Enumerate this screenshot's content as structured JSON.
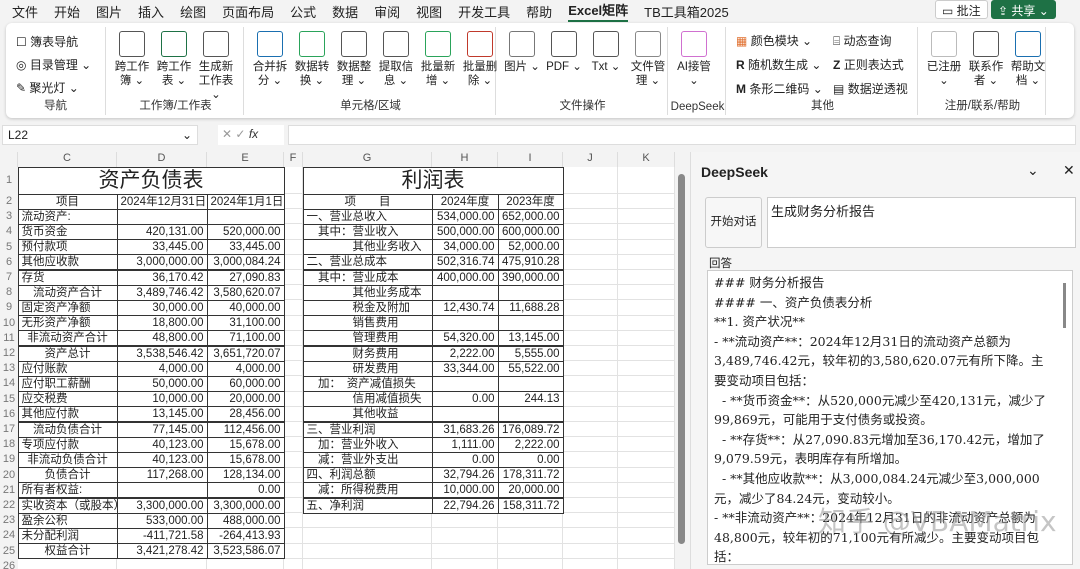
{
  "menu": {
    "tabs": [
      "文件",
      "开始",
      "图片",
      "插入",
      "绘图",
      "页面布局",
      "公式",
      "数据",
      "审阅",
      "视图",
      "开发工具",
      "帮助",
      "Excel矩阵",
      "TB工具箱2025"
    ],
    "active": "Excel矩阵",
    "comment": "批注",
    "share": "共享"
  },
  "ribbon": {
    "nav": {
      "items": [
        "簿表导航",
        "目录管理",
        "聚光灯"
      ],
      "label": "导航"
    },
    "wb": {
      "items": [
        "跨工作簿",
        "跨工作表",
        "生成新工作表"
      ],
      "label": "工作簿/工作表"
    },
    "cells": {
      "items": [
        "合并拆分",
        "数据转换",
        "数据整理",
        "提取信息",
        "批量新增",
        "批量删除"
      ],
      "label": "单元格/区域"
    },
    "file": {
      "items": [
        "图片",
        "PDF",
        "Txt",
        "文件管理"
      ],
      "label": "文件操作"
    },
    "ds": {
      "items": [
        "AI接管"
      ],
      "label": "DeepSeek"
    },
    "other": {
      "items": [
        "颜色模块",
        "随机数生成",
        "条形二维码",
        "动态查询",
        "正则表达式",
        "数据逆透视"
      ],
      "label": "其他"
    },
    "reg": {
      "items": [
        "已注册",
        "联系作者",
        "帮助文档"
      ],
      "label": "注册/联系/帮助"
    }
  },
  "formula": {
    "namebox": "L22",
    "fx": "fx",
    "value": ""
  },
  "sheet": {
    "columns": [
      "C",
      "D",
      "E",
      "F",
      "G",
      "H",
      "I",
      "J",
      "K"
    ],
    "balance": {
      "title": "资产负债表",
      "headers": [
        "项目",
        "2024年12月31日",
        "2024年1月1日"
      ],
      "rows": [
        [
          "流动资产:",
          "",
          ""
        ],
        [
          "货币资金",
          "420,131.00",
          "520,000.00"
        ],
        [
          "预付款项",
          "33,445.00",
          "33,445.00"
        ],
        [
          "其他应收款",
          "3,000,000.00",
          "3,000,084.24"
        ],
        [
          "存货",
          "36,170.42",
          "27,090.83"
        ],
        [
          "流动资产合计",
          "3,489,746.42",
          "3,580,620.07"
        ],
        [
          "固定资产净额",
          "30,000.00",
          "40,000.00"
        ],
        [
          "无形资产净额",
          "18,800.00",
          "31,100.00"
        ],
        [
          "非流动资产合计",
          "48,800.00",
          "71,100.00"
        ],
        [
          "资产总计",
          "3,538,546.42",
          "3,651,720.07"
        ],
        [
          "应付账款",
          "4,000.00",
          "4,000.00"
        ],
        [
          "应付职工薪酬",
          "50,000.00",
          "60,000.00"
        ],
        [
          "应交税费",
          "10,000.00",
          "20,000.00"
        ],
        [
          "其他应付款",
          "13,145.00",
          "28,456.00"
        ],
        [
          "流动负债合计",
          "77,145.00",
          "112,456.00"
        ],
        [
          "专项应付款",
          "40,123.00",
          "15,678.00"
        ],
        [
          "非流动负债合计",
          "40,123.00",
          "15,678.00"
        ],
        [
          "负债合计",
          "117,268.00",
          "128,134.00"
        ],
        [
          "所有者权益:",
          "",
          "0.00"
        ],
        [
          "实收资本（或股本）",
          "3,300,000.00",
          "3,300,000.00"
        ],
        [
          "盈余公积",
          "533,000.00",
          "488,000.00"
        ],
        [
          "未分配利润",
          "-411,721.58",
          "-264,413.93"
        ],
        [
          "权益合计",
          "3,421,278.42",
          "3,523,586.07"
        ]
      ]
    },
    "income": {
      "title": "利润表",
      "headers": [
        "项　　目",
        "2024年度",
        "2023年度"
      ],
      "rows": [
        [
          "一、营业总收入",
          "534,000.00",
          "652,000.00"
        ],
        [
          "　其中：营业收入",
          "500,000.00",
          "600,000.00"
        ],
        [
          "　　　　其他业务收入",
          "34,000.00",
          "52,000.00"
        ],
        [
          "二、营业总成本",
          "502,316.74",
          "475,910.28"
        ],
        [
          "　其中：营业成本",
          "400,000.00",
          "390,000.00"
        ],
        [
          "　　　　其他业务成本",
          "",
          ""
        ],
        [
          "　　　　税金及附加",
          "12,430.74",
          "11,688.28"
        ],
        [
          "　　　　销售费用",
          "",
          ""
        ],
        [
          "　　　　管理费用",
          "54,320.00",
          "13,145.00"
        ],
        [
          "　　　　财务费用",
          "2,222.00",
          "5,555.00"
        ],
        [
          "　　　　研发费用",
          "33,344.00",
          "55,522.00"
        ],
        [
          "　加：　资产减值损失",
          "",
          ""
        ],
        [
          "　　　　信用减值损失",
          "0.00",
          "244.13"
        ],
        [
          "　　　　其他收益",
          "",
          ""
        ],
        [
          "三、营业利润",
          "31,683.26",
          "176,089.72"
        ],
        [
          "　加：营业外收入",
          "1,111.00",
          "2,222.00"
        ],
        [
          "　减：营业外支出",
          "0.00",
          "0.00"
        ],
        [
          "四、利润总额",
          "32,794.26",
          "178,311.72"
        ],
        [
          "　减：所得税费用",
          "10,000.00",
          "20,000.00"
        ],
        [
          "五、净利润",
          "22,794.26",
          "158,311.72"
        ]
      ]
    }
  },
  "panel": {
    "title": "DeepSeek",
    "start": "开始对话",
    "question": "生成财务分析报告",
    "answer_label": "回答",
    "answer": [
      "### 财务分析报告",
      "#### 一、资产负债表分析",
      "**1. 资产状况**",
      "- **流动资产**：2024年12月31日的流动资产总额为3,489,746.42元，较年初的3,580,620.07元有所下降。主要变动项目包括：",
      "  - **货币资金**：从520,000元减少至420,131元，减少了99,869元，可能用于支付债务或投资。",
      "  - **存货**：从27,090.83元增加至36,170.42元，增加了9,079.59元，表明库存有所增加。",
      "  - **其他应收款**：从3,000,084.24元减少至3,000,000元，减少了84.24元，变动较小。",
      "- **非流动资产**：2024年12月31日的非流动资产总额为48,800元，较年初的71,100元有所减少。主要变动项目包括："
    ],
    "watermark": "知乎 @VBAMatrix"
  }
}
